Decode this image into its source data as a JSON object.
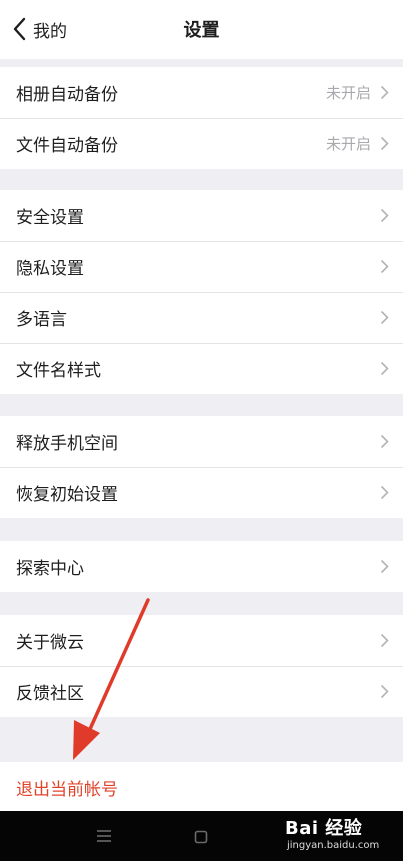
{
  "header": {
    "back_label": "我的",
    "title": "设置"
  },
  "groups": [
    {
      "items": [
        {
          "label": "相册自动备份",
          "value": "未开启"
        },
        {
          "label": "文件自动备份",
          "value": "未开启"
        }
      ]
    },
    {
      "items": [
        {
          "label": "安全设置"
        },
        {
          "label": "隐私设置"
        },
        {
          "label": "多语言"
        },
        {
          "label": "文件名样式"
        }
      ]
    },
    {
      "items": [
        {
          "label": "释放手机空间"
        },
        {
          "label": "恢复初始设置"
        }
      ]
    },
    {
      "items": [
        {
          "label": "探索中心"
        }
      ]
    },
    {
      "items": [
        {
          "label": "关于微云"
        },
        {
          "label": "反馈社区"
        }
      ]
    }
  ],
  "logout": {
    "label": "退出当前帐号"
  },
  "watermark": {
    "logo": "Bai 经验",
    "url": "jingyan.baidu.com"
  },
  "colors": {
    "background": "#efeff3",
    "logout_text": "#e0452c",
    "annotation_arrow": "#e03a2a",
    "value_text": "#a9a9ad"
  },
  "icons": {
    "back": "chevron-left-icon",
    "row": "chevron-right-icon",
    "nav_menu": "menu-icon",
    "nav_home": "home-square-icon"
  }
}
